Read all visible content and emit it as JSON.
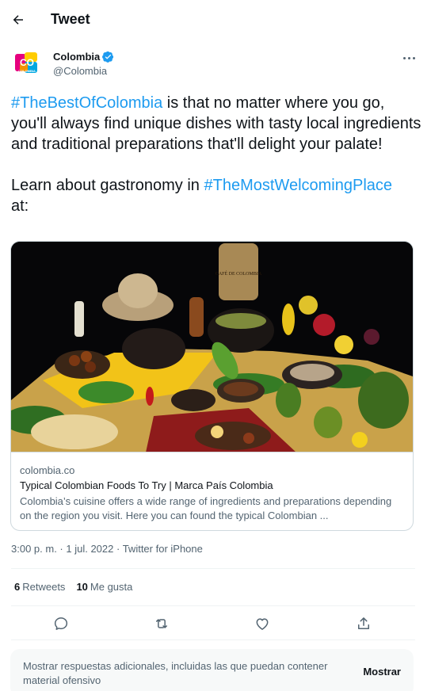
{
  "header": {
    "title": "Tweet"
  },
  "author": {
    "name": "Colombia",
    "handle": "@Colombia",
    "logo_text": "CO",
    "logo_subtext": "COLOMBIA",
    "verified": true
  },
  "tweet": {
    "hashtag1": "#TheBestOfColombia",
    "text1": " is that no matter where you go, you'll always find unique dishes with tasty local ingredients and traditional preparations that'll delight your palate!",
    "text2": "Learn about gastronomy in ",
    "hashtag2": "#TheMostWelcomingPlace",
    "text3": "at:"
  },
  "card": {
    "image_label": "CAFÉ DE COLOMBIA",
    "domain": "colombia.co",
    "title": "Typical Colombian Foods To Try | Marca País Colombia",
    "description": "Colombia’s cuisine offers a wide range of ingredients and preparations depending on the region you visit. Here you can found the typical Colombian ..."
  },
  "meta": {
    "time": "3:00 p. m.",
    "separator": " · ",
    "date": "1 jul. 2022",
    "source": "Twitter for iPhone"
  },
  "stats": {
    "retweets_count": "6",
    "retweets_label": "Retweets",
    "likes_count": "10",
    "likes_label": "Me gusta"
  },
  "more_replies": {
    "text": "Mostrar respuestas adicionales, incluidas las que puedan contener material ofensivo",
    "button": "Mostrar"
  },
  "colors": {
    "accent": "#1d9bf0",
    "text": "#0f1419",
    "secondary": "#536471",
    "border": "#cfd9de"
  },
  "icons": [
    "back-arrow-icon",
    "verified-badge-icon",
    "more-icon",
    "reply-icon",
    "retweet-icon",
    "like-icon",
    "share-icon"
  ]
}
